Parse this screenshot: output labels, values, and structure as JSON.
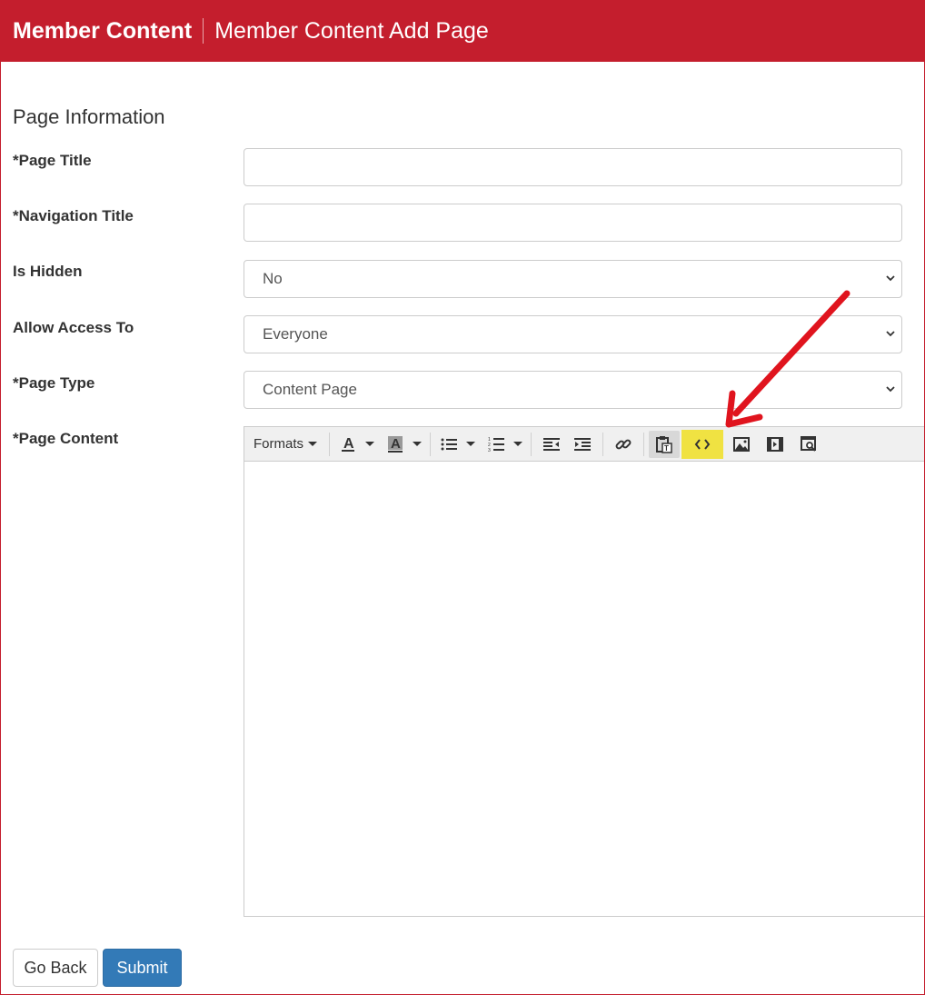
{
  "header": {
    "app_title": "Member Content",
    "page_title": "Member Content Add Page"
  },
  "form": {
    "section_title": "Page Information",
    "page_title_label": "*Page Title",
    "page_title_value": "",
    "navigation_title_label": "*Navigation Title",
    "navigation_title_value": "",
    "is_hidden_label": "Is Hidden",
    "is_hidden_value": "No",
    "allow_access_label": "Allow Access To",
    "allow_access_value": "Everyone",
    "page_type_label": "*Page Type",
    "page_type_value": "Content Page",
    "page_content_label": "*Page Content"
  },
  "editor": {
    "formats_label": "Formats",
    "toolbar_icons": [
      "text-color-icon",
      "background-color-icon",
      "bullet-list-icon",
      "numbered-list-icon",
      "outdent-icon",
      "indent-icon",
      "link-icon",
      "paste-text-icon",
      "source-code-icon",
      "image-icon",
      "media-icon",
      "preview-icon"
    ],
    "highlight_color": "#f0e242"
  },
  "buttons": {
    "go_back": "Go Back",
    "submit": "Submit"
  },
  "colors": {
    "header_bg": "#c41e2d",
    "submit_bg": "#337ab7",
    "annotation_arrow": "#e0141e"
  }
}
